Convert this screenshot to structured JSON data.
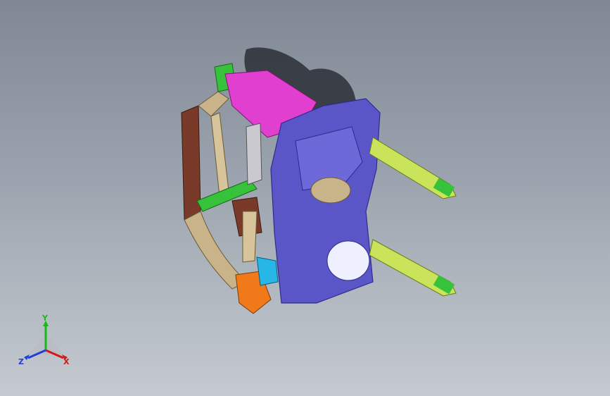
{
  "viewport": {
    "background_top": "#7f8893",
    "background_bottom": "#c5cad0"
  },
  "triad": {
    "x_label": "X",
    "y_label": "Y",
    "z_label": "Z",
    "x_color": "#d21a1a",
    "y_color": "#18b918",
    "z_color": "#1f3fd8"
  },
  "model": {
    "colors": {
      "panel_purple": "#5a56c8",
      "panel_purple_dark": "#2f2b8a",
      "magenta": "#e13fd0",
      "green": "#36c23a",
      "yellow_green": "#c9e35a",
      "brown": "#7a3a2a",
      "tan": "#c9b48a",
      "orange": "#f07a1a",
      "cyan": "#28b6e6",
      "shadow": "#2b2f36"
    }
  }
}
